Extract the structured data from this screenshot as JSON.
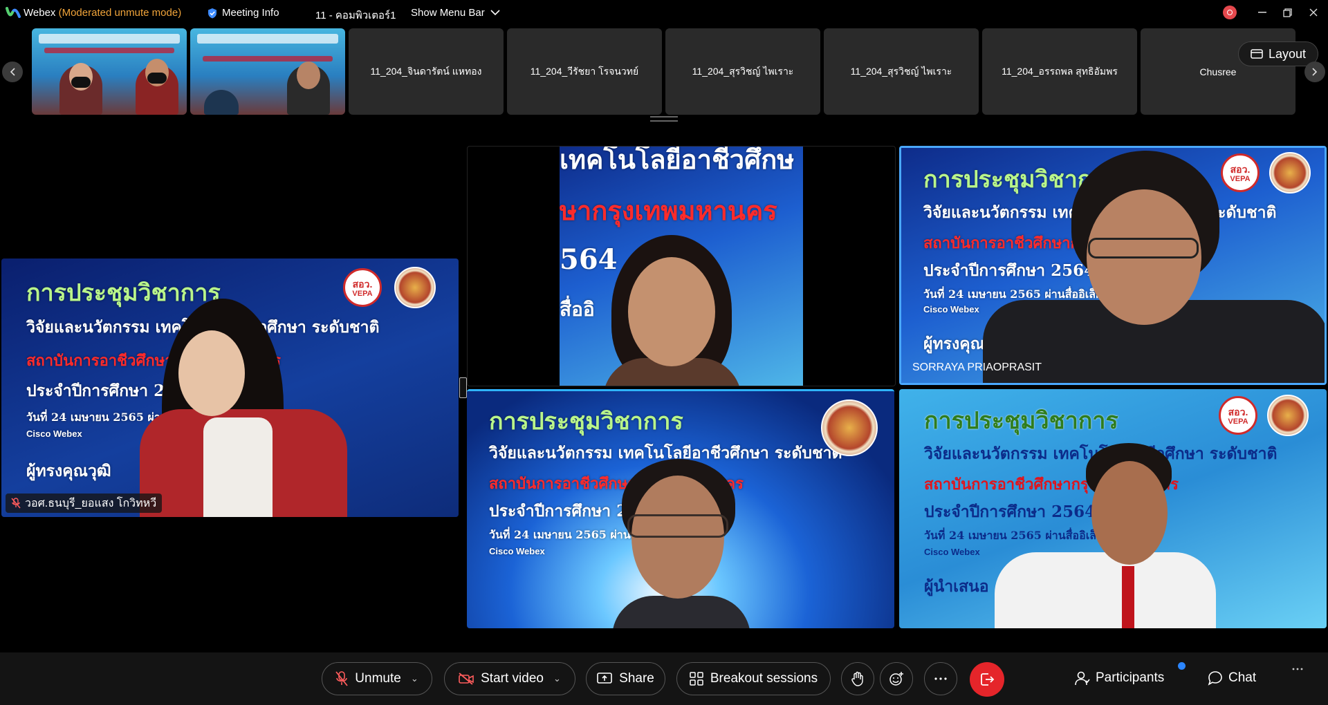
{
  "titlebar": {
    "app_name": "Webex",
    "mode": "(Moderated unmute mode)",
    "meeting_info": "Meeting Info",
    "meeting_title": "11 - คอมพิวเตอร์1",
    "show_menu_bar": "Show Menu Bar"
  },
  "filmstrip": {
    "participants": [
      "11_204_จินดารัตน์ แหทอง",
      "11_204_วีรัชยา โรจนวทย์",
      "11_204_สุรวิชญ์ ไพเราะ",
      "11_204_สุรวิชญ์ ไพเราะ",
      "11_204_อรรถพล สุทธิอัมพร",
      "Chusree"
    ],
    "layout_label": "Layout"
  },
  "slide": {
    "heading": "การประชุมวิชาการ",
    "line2": "วิจัยและนวัตกรรม เทคโนโลยีอาชีวศึกษา ระดับชาติ",
    "line3": "สถาบันการอาชีวศึกษากรุงเทพมหานคร",
    "line4": "ประจำปีการศึกษา 2564",
    "line5": "วันที่ 24 เมษายน 2565 ผ่านสื่ออิเล็กทรอนิกส์",
    "platform": "Cisco Webex",
    "role_qualified": "ผู้ทรงคุณวุฒิ",
    "role_presenter": "ผู้นำเสนอ",
    "top_fragment1": "เทคโนโลยีอาชีวศึกษ",
    "top_fragment2": "ษากรุงเทพมหานคร",
    "top_fragment3": "564",
    "top_fragment4": "สื่ออิ",
    "vepa_top": "สอว.",
    "vepa_bottom": "VEPA"
  },
  "tiles": {
    "left_name": "วอศ.ธนบุรี_ยอแสง โกวิทหวี",
    "right_top_name": "SORRAYA PRIAOPRASIT"
  },
  "controls": {
    "unmute": "Unmute",
    "start_video": "Start video",
    "share": "Share",
    "breakout": "Breakout sessions",
    "participants": "Participants",
    "chat": "Chat"
  },
  "colors": {
    "accent_orange": "#f0a43a",
    "leave_red": "#e5252a",
    "active_border": "#4aa8ff",
    "notification_blue": "#2b86ff"
  }
}
